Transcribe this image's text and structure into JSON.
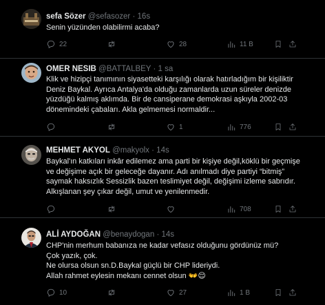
{
  "tweets": [
    {
      "name": "sefa Sözer",
      "handle": "@sefasozer",
      "sep": "·",
      "time": "16s",
      "lines": [
        "Senin yüzünden olabilirmi acaba?"
      ],
      "replies": "22",
      "retweets": "",
      "likes": "28",
      "views": "11 B"
    },
    {
      "name": "OMER NESIB",
      "handle": "@BATTALBEY",
      "sep": "·",
      "time": "1 sa",
      "lines": [
        "Klik ve hizipçi tanımının siyasetteki karşılığı olarak hatırladığım bir kişiliktir",
        "Deniz Baykal. Ayrıca Antalya'da olduğu zamanlarda uzun süreler denizde",
        "yüzdüğü kalmış aklımda.  Bir de cansiperane demokrasi aşkıyla 2002-03",
        "dönemindeki çabaları. Akla gelmemesi normaldir..."
      ],
      "replies": "",
      "retweets": "",
      "likes": "1",
      "views": "776"
    },
    {
      "name": "MEHMET AKYOL",
      "handle": "@makyolx",
      "sep": "·",
      "time": "14s",
      "lines": [
        "Baykal'ın katkıları inkâr edilemez ama parti bir kişiye değil,köklü bir geçmişe",
        "ve değişime açık bir geleceğe dayanır. Adı anılmadı diye partiyi “bitmiş”",
        "saymak haksızlık Sessizlik bazen teslimiyet değil, değişimi izleme sabrıdır.",
        "Alkışlanan şey çıkar değil, umut ve yenilenmedir."
      ],
      "replies": "",
      "retweets": "",
      "likes": "",
      "views": "708"
    },
    {
      "name": "ALİ AYDOĞAN",
      "handle": "@benaydogan",
      "sep": "·",
      "time": "14s",
      "lines": [
        "CHP'nin merhum babanıza ne kadar vefasız olduğunu gördünüz mü?",
        "Çok yazık, çok.",
        "Ne olursa olsun sn.D.Baykal güçlü bir CHP lideriydi.",
        "Allah rahmet eylesin mekanı cennet olsun 👐😌"
      ],
      "replies": "10",
      "retweets": "",
      "likes": "27",
      "views": "1 B"
    }
  ],
  "colors": {
    "background": "#000000",
    "text": "#e7e9ea",
    "muted": "#71767b",
    "divider": "#2f3336"
  },
  "icons": [
    "reply-icon",
    "retweet-icon",
    "like-icon",
    "views-icon",
    "bookmark-icon",
    "share-icon"
  ]
}
